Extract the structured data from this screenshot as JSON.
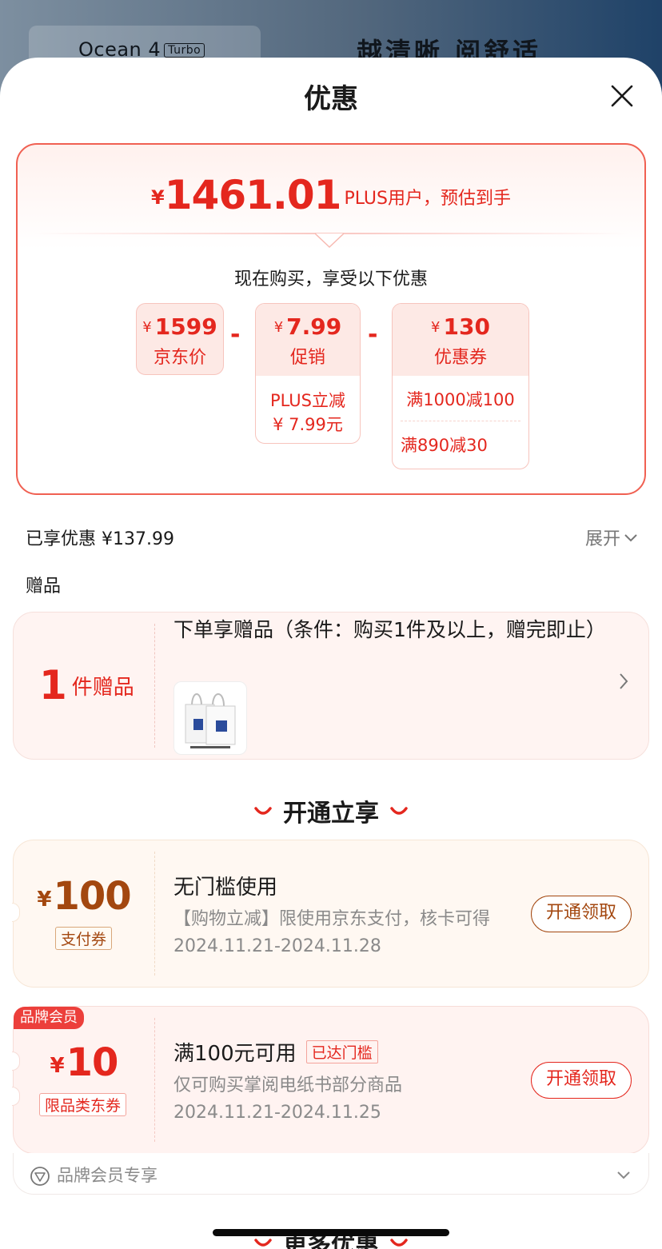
{
  "background": {
    "brand": "Ocean 4",
    "brand_badge": "Turbo",
    "slogan": "越清晰 阅舒适"
  },
  "sheet": {
    "title": "优惠"
  },
  "summary": {
    "currency": "¥",
    "estimated_price": "1461.01",
    "estimated_label": "PLUS用户，预估到手",
    "buy_now_text": "现在购买，享受以下优惠",
    "minus": "-",
    "items": [
      {
        "value": "1599",
        "label": "京东价"
      },
      {
        "value": "7.99",
        "label": "促销",
        "details": [
          "PLUS立减",
          "¥ 7.99元"
        ]
      },
      {
        "value": "130",
        "label": "优惠券",
        "details": [
          "满1000减100",
          "满890减30"
        ]
      }
    ]
  },
  "saved": {
    "text": "已享优惠 ¥137.99",
    "expand_label": "展开"
  },
  "gifts": {
    "section_title": "赠品",
    "count": "1",
    "count_label": "件赠品",
    "description": "下单享赠品（条件：购买1件及以上，赠完即止）"
  },
  "open_section": {
    "title": "开通立享"
  },
  "coupons": [
    {
      "currency": "¥",
      "amount": "100",
      "tag": "支付券",
      "title": "无门槛使用",
      "description": "【购物立减】限使用京东支付，核卡可得",
      "date": "2024.11.21-2024.11.28",
      "button": "开通领取"
    },
    {
      "badge": "品牌会员",
      "currency": "¥",
      "amount": "10",
      "tag": "限品类东券",
      "title": "满100元可用",
      "reached": "已达门槛",
      "description": "仅可购买掌阅电纸书部分商品",
      "date": "2024.11.21-2024.11.25",
      "button": "开通领取"
    }
  ],
  "brand_member": {
    "text": "品牌会员专享"
  },
  "more_section": {
    "title": "更多优惠"
  },
  "colors": {
    "accent_red": "#e4271e",
    "coupon_brown": "#a3470f",
    "border_red": "#f06052"
  }
}
